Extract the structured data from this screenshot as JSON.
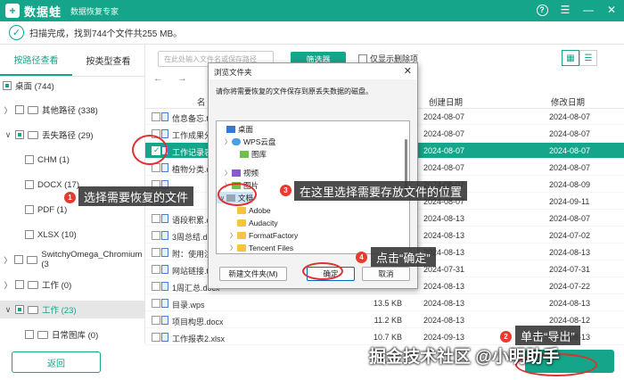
{
  "app": {
    "logo_char": "+",
    "name": "数据蛙",
    "subtitle": "数据恢复专家",
    "icons": [
      "help-icon",
      "menu-icon",
      "minimize-icon",
      "close-icon"
    ]
  },
  "status": {
    "text": "扫描完成，找到744个文件共255 MB。"
  },
  "left_tabs": [
    {
      "label": "按路径查看",
      "active": true
    },
    {
      "label": "按类型查看",
      "active": false
    }
  ],
  "tree": [
    {
      "label": "桌面 (744)"
    },
    {
      "label": "其他路径 (338)"
    },
    {
      "label": "丢失路径 (29)"
    },
    {
      "label": "CHM (1)"
    },
    {
      "label": "DOCX (17)"
    },
    {
      "label": "PDF (1)"
    },
    {
      "label": "XLSX (10)"
    },
    {
      "label": "SwitchyOmega_Chromium (3"
    },
    {
      "label": "工作 (0)"
    },
    {
      "label": "工作 (23)"
    },
    {
      "label": "日常图库 (0)"
    }
  ],
  "toolbar": {
    "search_placeholder": "在此处输入文件名或保存路径",
    "filter_label": "筛选器",
    "only_deleted_label": "仅显示删除项"
  },
  "table": {
    "headers": {
      "name": "名",
      "created": "创建日期",
      "modified": "修改日期"
    },
    "rows": [
      {
        "name": "信息备忘.t",
        "size": "",
        "created": "2024-08-07",
        "modified": "2024-08-07"
      },
      {
        "name": "工作成果分",
        "size": "",
        "created": "2024-08-07",
        "modified": "2024-08-07"
      },
      {
        "name": "工作记录表",
        "size": "",
        "created": "2024-08-07",
        "modified": "2024-08-07"
      },
      {
        "name": "植物分类.d",
        "size": "",
        "created": "2024-08-07",
        "modified": "2024-08-07"
      },
      {
        "name": "",
        "size": "",
        "created": "2024-08-07",
        "modified": "2024-08-09"
      },
      {
        "name": "",
        "size": "",
        "created": "2024-08-07",
        "modified": "2024-09-11"
      },
      {
        "name": "语段积累.d",
        "size": "",
        "created": "2024-08-13",
        "modified": "2024-08-07"
      },
      {
        "name": "3周总结.docx",
        "size": "",
        "created": "2024-08-13",
        "modified": "2024-07-02"
      },
      {
        "name": "附：使用注",
        "size": "",
        "created": "2024-08-13",
        "modified": "2024-08-13"
      },
      {
        "name": "网站链接.txt",
        "size": "",
        "created": "2024-07-31",
        "modified": "2024-07-31"
      },
      {
        "name": "1周汇总.docx",
        "size": "",
        "created": "2024-08-13",
        "modified": "2024-07-22"
      },
      {
        "name": "目录.wps",
        "size": "13.5 KB",
        "created": "2024-08-13",
        "modified": "2024-08-13"
      },
      {
        "name": "项目构思.docx",
        "size": "11.2 KB",
        "created": "2024-08-13",
        "modified": "2024-08-12"
      },
      {
        "name": "工作报表2.xlsx",
        "size": "10.7 KB",
        "created": "2024-09-13",
        "modified": "2024-08-13"
      }
    ]
  },
  "dialog": {
    "title": "浏览文件夹",
    "description": "请你将需要恢复的文件保存到原丢失数据的磁盘。",
    "tree": [
      {
        "label": "桌面",
        "icon": "desktop-icon"
      },
      {
        "label": "WPS云盘",
        "icon": "cloud-icon"
      },
      {
        "label": "图库",
        "icon": "gallery-icon"
      },
      {
        "label": "视频",
        "icon": "video-icon"
      },
      {
        "label": "图片",
        "icon": "image-icon"
      },
      {
        "label": "文档",
        "icon": "documents-icon"
      },
      {
        "label": "Adobe",
        "icon": "folder-icon"
      },
      {
        "label": "Audacity",
        "icon": "folder-icon"
      },
      {
        "label": "FormatFactory",
        "icon": "folder-icon"
      },
      {
        "label": "Tencent Files",
        "icon": "folder-icon"
      },
      {
        "label": "WPSDrive",
        "icon": "folder-icon"
      }
    ],
    "new_folder_label": "新建文件夹(M)",
    "ok_label": "确定",
    "cancel_label": "取消"
  },
  "annotations": {
    "step1": {
      "num": "1",
      "text": "选择需要恢复的文件"
    },
    "step2": {
      "num": "2",
      "text": "单击“导出”"
    },
    "step3": {
      "num": "3",
      "text": "在这里选择需要存放文件的位置"
    },
    "step4": {
      "num": "4",
      "text": "点击“确定”"
    }
  },
  "back_label": "返回",
  "watermark": "掘金技术社区 @小明助手"
}
